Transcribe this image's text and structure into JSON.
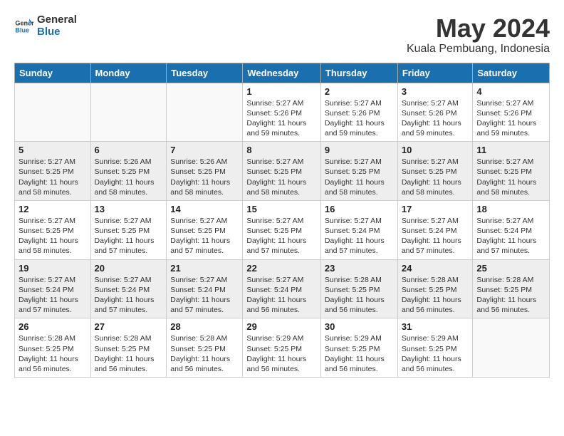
{
  "logo": {
    "line1": "General",
    "line2": "Blue"
  },
  "title": "May 2024",
  "location": "Kuala Pembuang, Indonesia",
  "days_of_week": [
    "Sunday",
    "Monday",
    "Tuesday",
    "Wednesday",
    "Thursday",
    "Friday",
    "Saturday"
  ],
  "weeks": [
    [
      {
        "day": "",
        "info": ""
      },
      {
        "day": "",
        "info": ""
      },
      {
        "day": "",
        "info": ""
      },
      {
        "day": "1",
        "info": "Sunrise: 5:27 AM\nSunset: 5:26 PM\nDaylight: 11 hours\nand 59 minutes."
      },
      {
        "day": "2",
        "info": "Sunrise: 5:27 AM\nSunset: 5:26 PM\nDaylight: 11 hours\nand 59 minutes."
      },
      {
        "day": "3",
        "info": "Sunrise: 5:27 AM\nSunset: 5:26 PM\nDaylight: 11 hours\nand 59 minutes."
      },
      {
        "day": "4",
        "info": "Sunrise: 5:27 AM\nSunset: 5:26 PM\nDaylight: 11 hours\nand 59 minutes."
      }
    ],
    [
      {
        "day": "5",
        "info": "Sunrise: 5:27 AM\nSunset: 5:25 PM\nDaylight: 11 hours\nand 58 minutes."
      },
      {
        "day": "6",
        "info": "Sunrise: 5:26 AM\nSunset: 5:25 PM\nDaylight: 11 hours\nand 58 minutes."
      },
      {
        "day": "7",
        "info": "Sunrise: 5:26 AM\nSunset: 5:25 PM\nDaylight: 11 hours\nand 58 minutes."
      },
      {
        "day": "8",
        "info": "Sunrise: 5:27 AM\nSunset: 5:25 PM\nDaylight: 11 hours\nand 58 minutes."
      },
      {
        "day": "9",
        "info": "Sunrise: 5:27 AM\nSunset: 5:25 PM\nDaylight: 11 hours\nand 58 minutes."
      },
      {
        "day": "10",
        "info": "Sunrise: 5:27 AM\nSunset: 5:25 PM\nDaylight: 11 hours\nand 58 minutes."
      },
      {
        "day": "11",
        "info": "Sunrise: 5:27 AM\nSunset: 5:25 PM\nDaylight: 11 hours\nand 58 minutes."
      }
    ],
    [
      {
        "day": "12",
        "info": "Sunrise: 5:27 AM\nSunset: 5:25 PM\nDaylight: 11 hours\nand 58 minutes."
      },
      {
        "day": "13",
        "info": "Sunrise: 5:27 AM\nSunset: 5:25 PM\nDaylight: 11 hours\nand 57 minutes."
      },
      {
        "day": "14",
        "info": "Sunrise: 5:27 AM\nSunset: 5:25 PM\nDaylight: 11 hours\nand 57 minutes."
      },
      {
        "day": "15",
        "info": "Sunrise: 5:27 AM\nSunset: 5:25 PM\nDaylight: 11 hours\nand 57 minutes."
      },
      {
        "day": "16",
        "info": "Sunrise: 5:27 AM\nSunset: 5:24 PM\nDaylight: 11 hours\nand 57 minutes."
      },
      {
        "day": "17",
        "info": "Sunrise: 5:27 AM\nSunset: 5:24 PM\nDaylight: 11 hours\nand 57 minutes."
      },
      {
        "day": "18",
        "info": "Sunrise: 5:27 AM\nSunset: 5:24 PM\nDaylight: 11 hours\nand 57 minutes."
      }
    ],
    [
      {
        "day": "19",
        "info": "Sunrise: 5:27 AM\nSunset: 5:24 PM\nDaylight: 11 hours\nand 57 minutes."
      },
      {
        "day": "20",
        "info": "Sunrise: 5:27 AM\nSunset: 5:24 PM\nDaylight: 11 hours\nand 57 minutes."
      },
      {
        "day": "21",
        "info": "Sunrise: 5:27 AM\nSunset: 5:24 PM\nDaylight: 11 hours\nand 57 minutes."
      },
      {
        "day": "22",
        "info": "Sunrise: 5:27 AM\nSunset: 5:24 PM\nDaylight: 11 hours\nand 56 minutes."
      },
      {
        "day": "23",
        "info": "Sunrise: 5:28 AM\nSunset: 5:25 PM\nDaylight: 11 hours\nand 56 minutes."
      },
      {
        "day": "24",
        "info": "Sunrise: 5:28 AM\nSunset: 5:25 PM\nDaylight: 11 hours\nand 56 minutes."
      },
      {
        "day": "25",
        "info": "Sunrise: 5:28 AM\nSunset: 5:25 PM\nDaylight: 11 hours\nand 56 minutes."
      }
    ],
    [
      {
        "day": "26",
        "info": "Sunrise: 5:28 AM\nSunset: 5:25 PM\nDaylight: 11 hours\nand 56 minutes."
      },
      {
        "day": "27",
        "info": "Sunrise: 5:28 AM\nSunset: 5:25 PM\nDaylight: 11 hours\nand 56 minutes."
      },
      {
        "day": "28",
        "info": "Sunrise: 5:28 AM\nSunset: 5:25 PM\nDaylight: 11 hours\nand 56 minutes."
      },
      {
        "day": "29",
        "info": "Sunrise: 5:29 AM\nSunset: 5:25 PM\nDaylight: 11 hours\nand 56 minutes."
      },
      {
        "day": "30",
        "info": "Sunrise: 5:29 AM\nSunset: 5:25 PM\nDaylight: 11 hours\nand 56 minutes."
      },
      {
        "day": "31",
        "info": "Sunrise: 5:29 AM\nSunset: 5:25 PM\nDaylight: 11 hours\nand 56 minutes."
      },
      {
        "day": "",
        "info": ""
      }
    ]
  ]
}
